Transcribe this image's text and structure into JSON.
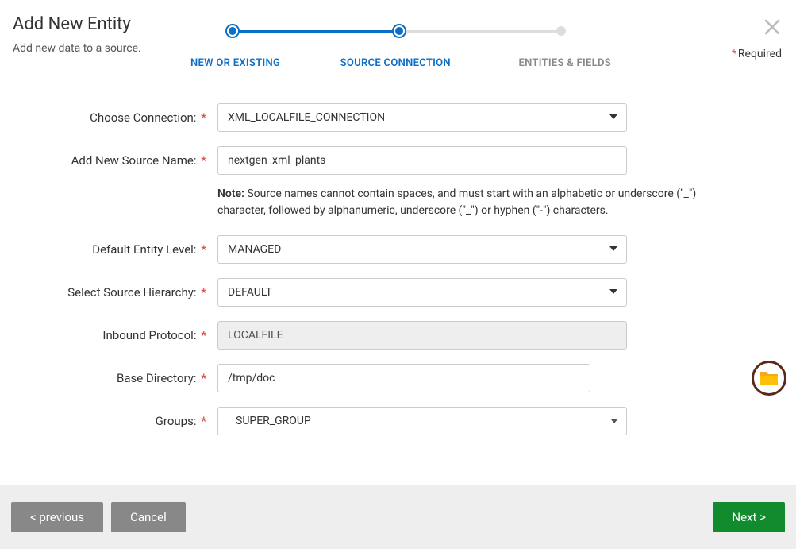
{
  "header": {
    "title": "Add New Entity",
    "subtitle": "Add new data to a source.",
    "required_label": "Required"
  },
  "stepper": {
    "step1": "NEW OR EXISTING",
    "step2": "SOURCE CONNECTION",
    "step3": "ENTITIES & FIELDS"
  },
  "form": {
    "connection": {
      "label": "Choose Connection:",
      "value": "XML_LOCALFILE_CONNECTION"
    },
    "source_name": {
      "label": "Add New Source Name:",
      "value": "nextgen_xml_plants"
    },
    "note_prefix": "Note:",
    "note_text": " Source names cannot contain spaces, and must start with an alphabetic or underscore (\"_\") character, followed by alphanumeric, underscore (\"_\") or hyphen (\"-\") characters.",
    "entity_level": {
      "label": "Default Entity Level:",
      "value": "MANAGED"
    },
    "hierarchy": {
      "label": "Select Source Hierarchy:",
      "value": "DEFAULT"
    },
    "protocol": {
      "label": "Inbound Protocol:",
      "value": "LOCALFILE"
    },
    "basedir": {
      "label": "Base Directory:",
      "value": "/tmp/doc"
    },
    "groups": {
      "label": "Groups:",
      "value": "SUPER_GROUP"
    }
  },
  "footer": {
    "previous": "< previous",
    "cancel": "Cancel",
    "next": "Next >"
  }
}
